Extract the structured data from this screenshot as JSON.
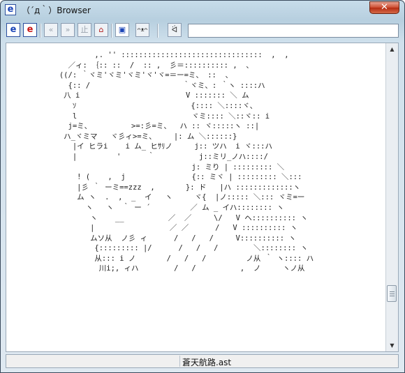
{
  "window": {
    "title": "（´д｀）Browser",
    "close_glyph": "✕"
  },
  "toolbar": {
    "buttons": [
      {
        "icon": "e-blue-icon",
        "glyph": "e"
      },
      {
        "icon": "e-red-icon",
        "glyph": "e"
      },
      {
        "icon": "back-icon",
        "glyph": "«"
      },
      {
        "icon": "forward-icon",
        "glyph": "»"
      },
      {
        "icon": "stop-icon",
        "glyph": "止"
      },
      {
        "icon": "home-icon",
        "glyph": "⌂"
      },
      {
        "icon": "favorites-icon",
        "glyph": "▣"
      },
      {
        "icon": "face-icon",
        "glyph": "ᴖᴥᴖ"
      },
      {
        "icon": "go-icon",
        "glyph": "ᐛ"
      }
    ],
    "url_value": ""
  },
  "content": {
    "ascii_art": "                    ,. '' ::::::::::::::::::::::::::::::::  ,  ,\n              ／ィ: ｛:: ::  /  :: ,  彡＝:::::::::: ,  、\n            ((/: ｀ヾミ'ヾミ'ヾミ'ヾ'ヾ=＝ー=ミ、 ::  、\n              {:: /                     ｀ヾミ、: ｀ヽ ::::ハ\n             八 i                        V ::::::: ＼ ム\n               ｿ                          {:::: ＼::::ヾ、\n               l                          ヾミ:::: ＼::ヾ:: i\n              j=ミ、         >=:彡=ミ、  ハ :: ヾ:::::ヽ ::|\n             ハ_ヾミマ   ヾ彡ィ>=ミ、    |: ム ＼::::::}\n               |イ ヒラi    i ム_ ヒｻﾘノ     j:: ツハ  i ヾ:::ハ\n               |         '      ｀          j::ミリ_ノハ::::/\n                                          j: ミり | ::::::::: ＼\n                ! (    ,  j               {:: ミヾ | ::::::::: ＼:::\n                |彡 ｀ ーミ==zzz  ,       }: ド   |ハ :::::::::::::ヽ\n                ム ヽ  .  ,  _  イ   ヽ     ヾ{  |ノ::::: ＼::: ヾミ=ー\n                  ヽ   ヽ  ｀ ー ´         ／ ム _ イハ:::::::: ヽ\n                   ヽ    __          ／  ／     \\/   V ヘ:::::::::: ヽ\n                   |                 ／ ／      /   V :::::::::: ヽ\n                   ムソ从  ノ彡 ィ      /   /   /     V:::::::::: ヽ\n                    {::::::::: |/      /   /   /        ＼:::::::: ヽ\n                    从::: i ノ       /   /   /         ノ从 ｀ ヽ:::: ハ\n                     川i;, ィハ        /   /          ,  ノ     ヽノ从"
  },
  "status": {
    "filename": "蒼天航路.ast"
  }
}
